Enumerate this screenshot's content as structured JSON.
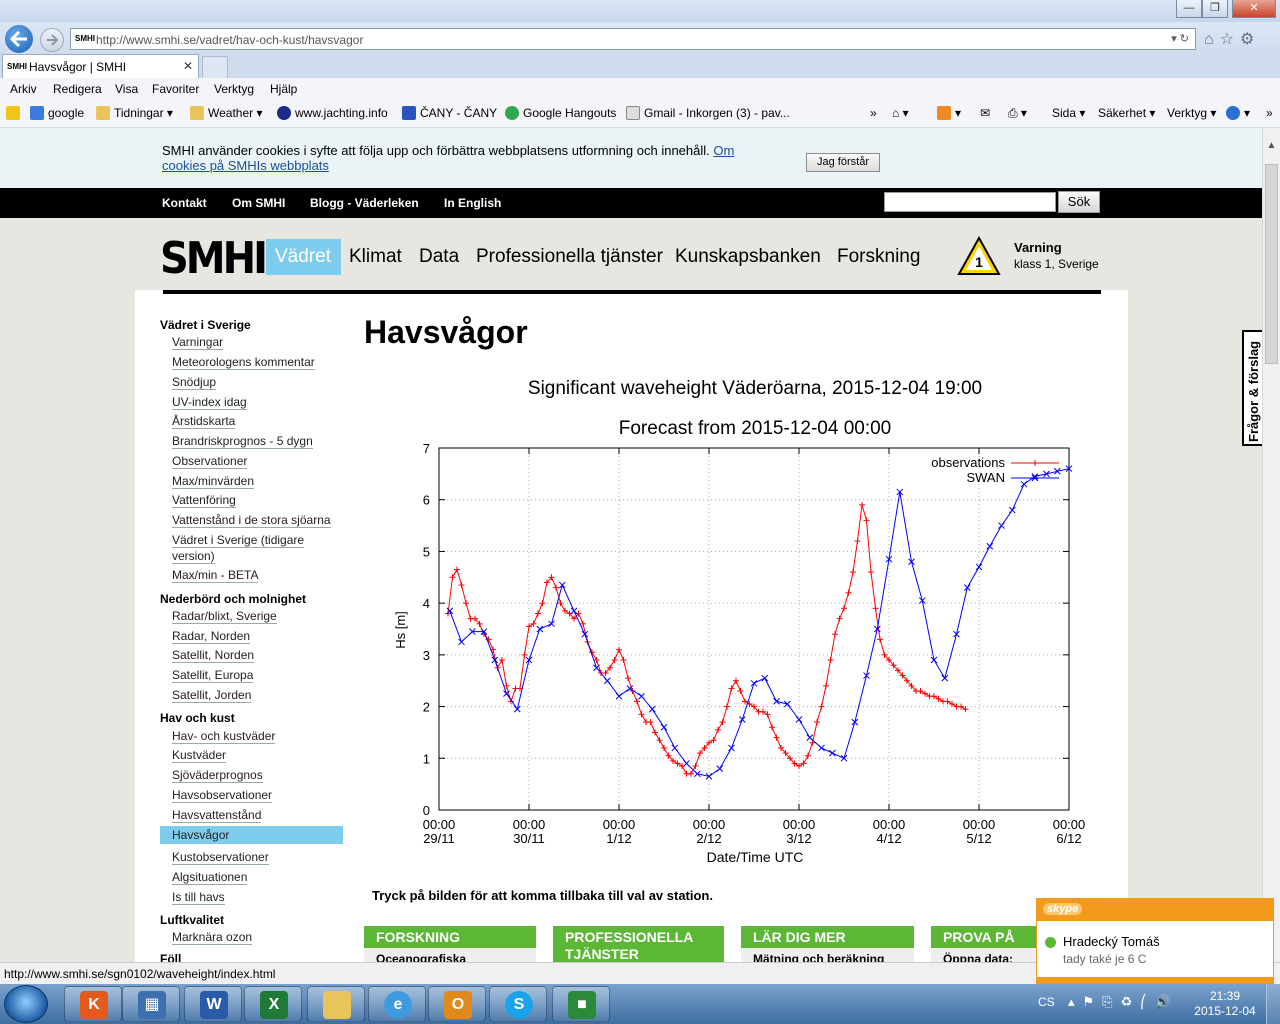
{
  "browser": {
    "url": "http://www.smhi.se/vadret/hav-och-kust/havsvagor",
    "tab_title": "Havsvågor | SMHI",
    "menu": [
      "Arkiv",
      "Redigera",
      "Visa",
      "Favoriter",
      "Verktyg",
      "Hjälp"
    ],
    "favorites": [
      "google",
      "Tidningar",
      "Weather",
      "www.jachting.info",
      "ČANY - ČANY",
      "Google Hangouts",
      "Gmail - Inkorgen (3) - pav..."
    ],
    "tools": [
      "Sida",
      "Säkerhet",
      "Verktyg"
    ],
    "status_url": "http://www.smhi.se/sgn0102/waveheight/index.html"
  },
  "cookie": {
    "text": "SMHI använder cookies i syfte att följa upp och förbättra webbplatsens utformning och innehåll.",
    "link": "Om cookies på SMHIs webbplats",
    "button": "Jag förstår"
  },
  "topnav": {
    "items": [
      "Kontakt",
      "Om SMHI",
      "Blogg - Väderleken",
      "In English"
    ],
    "search_button": "Sök"
  },
  "header": {
    "logo": "SMHI",
    "nav": [
      "Vädret",
      "Klimat",
      "Data",
      "Professionella tjänster",
      "Kunskapsbanken",
      "Forskning"
    ],
    "warning_level": "1",
    "warning_title": "Varning",
    "warning_sub": "klass 1, Sverige"
  },
  "sidebar": {
    "sections": [
      {
        "heading": "Vädret i Sverige",
        "links": [
          "Varningar",
          "Meteorologens kommentar",
          "Snödjup",
          "UV-index idag",
          "Årstidskarta",
          "Brandriskprognos - 5 dygn",
          "Observationer",
          "Max/minvärden",
          "Vattenföring",
          "Vattenstånd i de stora sjöarna",
          "Vädret i Sverige (tidigare",
          "version)",
          "Max/min - BETA"
        ]
      },
      {
        "heading": "Nederbörd och molnighet",
        "links": [
          "Radar/blixt, Sverige",
          "Radar, Norden",
          "Satellit, Norden",
          "Satellit, Europa",
          "Satellit, Jorden"
        ]
      },
      {
        "heading": "Hav och kust",
        "links": [
          "Hav- och kustväder",
          "Kustväder",
          "Sjöväderprognos",
          "Havsobservationer",
          "Havsvattenstånd",
          "Havsvågor",
          "Kustobservationer",
          "Algsituationen",
          "Is till havs"
        ]
      },
      {
        "heading": "Luftkvalitet",
        "links": [
          "Marknära ozon"
        ]
      },
      {
        "heading": "Föll",
        "links": []
      }
    ]
  },
  "main": {
    "title": "Havsvågor",
    "back_note": "Tryck på bilden för att komma tillbaka till val av station."
  },
  "promos": [
    {
      "title": "FORSKNING",
      "body": "Oceanografiska"
    },
    {
      "title": "PROFESSIONELLA TJÄNSTER",
      "body": ""
    },
    {
      "title": "LÄR DIG MER",
      "body": "Mätning och beräkning"
    },
    {
      "title": "PROVA PÅ",
      "body": "Öppna data:"
    }
  ],
  "feedback_tab": "Frågor & förslag",
  "chart_data": {
    "type": "line",
    "title": "Significant waveheight Väderöarna, 2015-12-04 19:00",
    "subtitle": "Forecast from 2015-12-04 00:00",
    "xlabel": "Date/Time UTC",
    "ylabel": "Hs [m]",
    "ylim": [
      0,
      7
    ],
    "xlim": [
      0,
      7
    ],
    "x_ticks": [
      {
        "time": "00:00",
        "date": "29/11"
      },
      {
        "time": "00:00",
        "date": "30/11"
      },
      {
        "time": "00:00",
        "date": "1/12"
      },
      {
        "time": "00:00",
        "date": "2/12"
      },
      {
        "time": "00:00",
        "date": "3/12"
      },
      {
        "time": "00:00",
        "date": "4/12"
      },
      {
        "time": "00:00",
        "date": "5/12"
      },
      {
        "time": "00:00",
        "date": "6/12"
      }
    ],
    "y_ticks": [
      0,
      1,
      2,
      3,
      4,
      5,
      6,
      7
    ],
    "grid": true,
    "legend": "top-right",
    "series": [
      {
        "name": "observations",
        "color": "#ff0000",
        "marker": "+",
        "x": [
          0.1,
          0.15,
          0.2,
          0.25,
          0.3,
          0.35,
          0.4,
          0.45,
          0.5,
          0.55,
          0.6,
          0.65,
          0.7,
          0.75,
          0.8,
          0.85,
          0.9,
          0.95,
          1.0,
          1.05,
          1.1,
          1.15,
          1.2,
          1.25,
          1.3,
          1.35,
          1.4,
          1.45,
          1.5,
          1.55,
          1.6,
          1.65,
          1.7,
          1.75,
          1.8,
          1.85,
          1.9,
          1.95,
          2.0,
          2.05,
          2.1,
          2.15,
          2.2,
          2.25,
          2.3,
          2.35,
          2.4,
          2.45,
          2.5,
          2.55,
          2.6,
          2.65,
          2.7,
          2.75,
          2.8,
          2.85,
          2.9,
          2.95,
          3.0,
          3.05,
          3.1,
          3.15,
          3.2,
          3.25,
          3.3,
          3.35,
          3.4,
          3.45,
          3.5,
          3.55,
          3.6,
          3.65,
          3.7,
          3.75,
          3.8,
          3.85,
          3.9,
          3.95,
          4.0,
          4.05,
          4.1,
          4.15,
          4.2,
          4.25,
          4.3,
          4.35,
          4.4,
          4.45,
          4.5,
          4.55,
          4.6,
          4.65,
          4.7,
          4.75,
          4.8,
          4.85,
          4.9,
          4.95,
          5.0,
          5.05,
          5.1,
          5.15,
          5.2,
          5.25,
          5.3,
          5.35,
          5.4,
          5.45,
          5.5,
          5.55,
          5.6,
          5.65,
          5.7,
          5.75,
          5.8,
          5.85
        ],
        "y": [
          3.8,
          4.5,
          4.65,
          4.35,
          4.0,
          3.7,
          3.7,
          3.6,
          3.4,
          3.3,
          3.1,
          2.75,
          2.9,
          2.4,
          2.1,
          2.35,
          2.35,
          3.0,
          3.55,
          3.6,
          3.8,
          4.0,
          4.4,
          4.5,
          4.3,
          4.0,
          3.85,
          3.8,
          3.7,
          3.8,
          3.6,
          3.25,
          3.05,
          2.9,
          2.65,
          2.65,
          2.75,
          2.9,
          3.1,
          2.9,
          2.55,
          2.3,
          2.1,
          1.85,
          1.7,
          1.7,
          1.5,
          1.35,
          1.2,
          1.05,
          0.95,
          0.9,
          0.85,
          0.7,
          0.7,
          0.85,
          1.1,
          1.2,
          1.3,
          1.35,
          1.55,
          1.7,
          2.0,
          2.35,
          2.5,
          2.3,
          2.1,
          2.05,
          2.0,
          1.9,
          1.9,
          1.85,
          1.6,
          1.4,
          1.2,
          1.1,
          1.0,
          0.9,
          0.85,
          0.9,
          1.05,
          1.3,
          1.7,
          2.0,
          2.4,
          2.9,
          3.4,
          3.7,
          3.9,
          4.2,
          4.6,
          5.2,
          5.9,
          5.6,
          4.6,
          3.9,
          3.3,
          3.0,
          2.9,
          2.8,
          2.7,
          2.6,
          2.5,
          2.4,
          2.3,
          2.3,
          2.25,
          2.2,
          2.2,
          2.15,
          2.1,
          2.1,
          2.05,
          2.0,
          2.0,
          1.95
        ]
      },
      {
        "name": "SWAN",
        "color": "#0000ff",
        "marker": "x",
        "x": [
          0.12,
          0.25,
          0.37,
          0.5,
          0.62,
          0.75,
          0.87,
          1.0,
          1.12,
          1.25,
          1.37,
          1.5,
          1.62,
          1.75,
          1.87,
          2.0,
          2.12,
          2.25,
          2.37,
          2.5,
          2.62,
          2.75,
          2.87,
          3.0,
          3.12,
          3.25,
          3.37,
          3.5,
          3.62,
          3.75,
          3.87,
          4.0,
          4.12,
          4.25,
          4.37,
          4.5,
          4.62,
          4.75,
          4.87,
          5.0,
          5.12,
          5.25,
          5.37,
          5.5,
          5.62,
          5.75,
          5.87,
          6.0,
          6.12,
          6.25,
          6.37,
          6.5,
          6.62,
          6.75,
          6.87,
          7.0
        ],
        "y": [
          3.85,
          3.25,
          3.45,
          3.45,
          2.9,
          2.25,
          1.95,
          2.9,
          3.5,
          3.6,
          4.35,
          3.85,
          3.4,
          2.75,
          2.5,
          2.2,
          2.35,
          2.2,
          1.95,
          1.6,
          1.2,
          0.9,
          0.7,
          0.65,
          0.8,
          1.2,
          1.75,
          2.45,
          2.55,
          2.1,
          2.05,
          1.75,
          1.4,
          1.2,
          1.1,
          1.0,
          1.7,
          2.6,
          3.5,
          4.85,
          6.15,
          4.8,
          4.05,
          2.9,
          2.55,
          3.4,
          4.3,
          4.7,
          5.1,
          5.5,
          5.8,
          6.3,
          6.45,
          6.5,
          6.55,
          6.6
        ]
      }
    ]
  },
  "skype": {
    "brand": "skype",
    "name": "Hradecký Tomáš",
    "message": "tady také je 6 C"
  },
  "taskbar": {
    "lang": "CS",
    "time": "21:39",
    "date": "2015-12-04"
  }
}
